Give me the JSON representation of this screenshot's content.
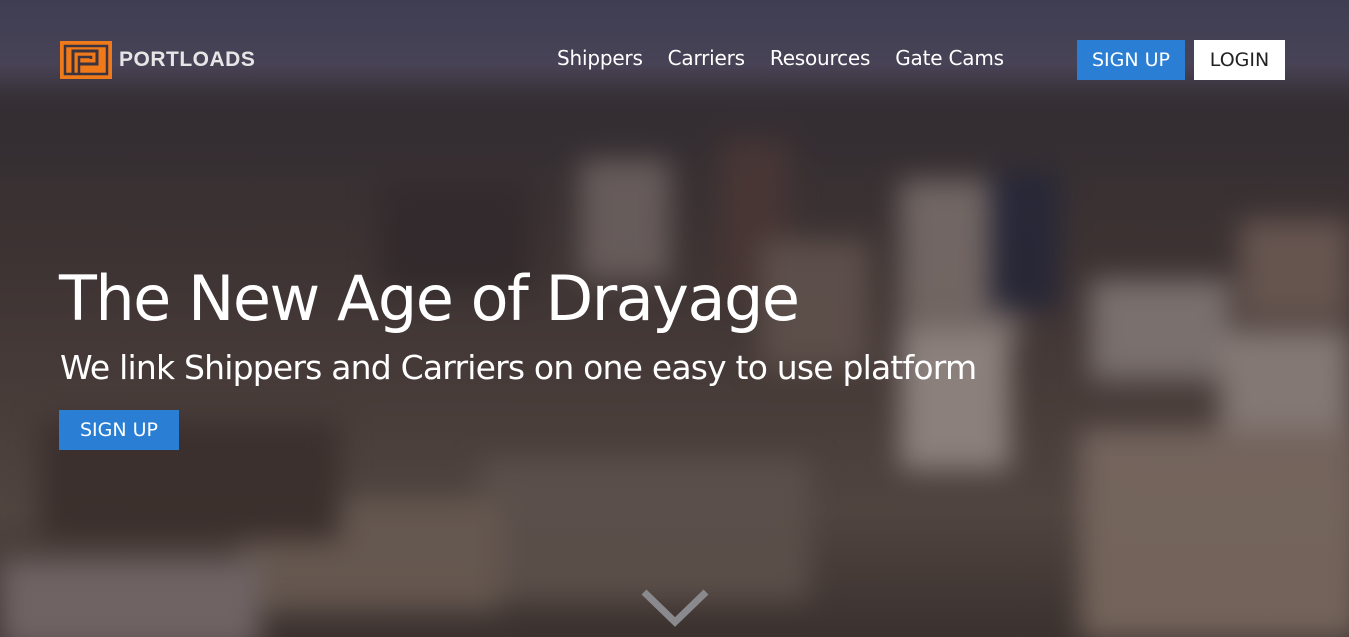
{
  "brand": {
    "name": "PORTLOADS",
    "accent": "#f07a1a",
    "logo_icon": "portloads-logo-icon"
  },
  "nav": {
    "items": [
      {
        "label": "Shippers"
      },
      {
        "label": "Carriers"
      },
      {
        "label": "Resources"
      },
      {
        "label": "Gate Cams"
      }
    ]
  },
  "header": {
    "signup_label": "SIGN UP",
    "login_label": "LOGIN"
  },
  "hero": {
    "title": "The New Age of Drayage",
    "subtitle": "We link Shippers and Carriers on one easy to use platform",
    "cta_label": "SIGN UP",
    "scroll_icon": "chevron-down-icon",
    "background": "blurred-city-aerial-photo"
  },
  "colors": {
    "primary_button": "#2a7fd4",
    "login_button": "#ffffff",
    "text": "#ffffff"
  }
}
